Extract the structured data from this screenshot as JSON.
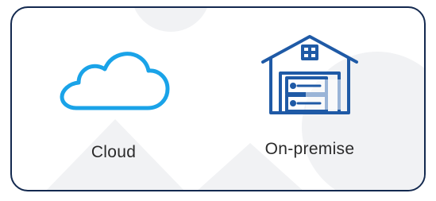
{
  "options": [
    {
      "id": "cloud",
      "label": "Cloud",
      "icon": "cloud-icon"
    },
    {
      "id": "on_premise",
      "label": "On-premise",
      "icon": "warehouse-icon"
    }
  ],
  "colors": {
    "frame_border": "#13294f",
    "cloud_icon": "#1aa3e8",
    "building_icon": "#1f5aa6",
    "label_text": "#2a2a2a",
    "watermark": "#f1f2f4"
  }
}
